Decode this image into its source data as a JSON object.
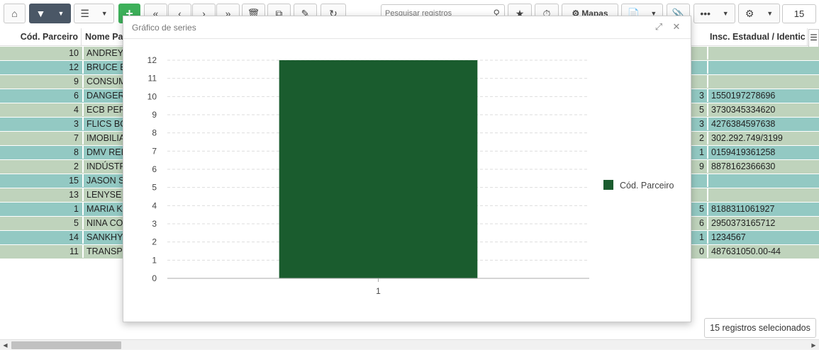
{
  "toolbar": {
    "search_placeholder": "Pesquisar registros",
    "mapas_label": "Mapas",
    "page_size": "15"
  },
  "grid": {
    "headers": {
      "cod": "Cód. Parceiro",
      "nome": "Nome Pa",
      "insc": "Insc. Estadual / Identic"
    },
    "rows": [
      {
        "cod": "10",
        "nome": "ANDREY",
        "mid": "",
        "insc": "",
        "color": "#bfd3bc"
      },
      {
        "cod": "12",
        "nome": "BRUCE E",
        "mid": "",
        "insc": "",
        "color": "#93c9c3"
      },
      {
        "cod": "9",
        "nome": "CONSUM",
        "mid": "",
        "insc": "",
        "color": "#bfd3bc"
      },
      {
        "cod": "6",
        "nome": "DANGER",
        "mid": "3",
        "insc": "1550197278696",
        "color": "#93c9c3"
      },
      {
        "cod": "4",
        "nome": "ECB PER",
        "mid": "5",
        "insc": "3730345334620",
        "color": "#bfd3bc"
      },
      {
        "cod": "3",
        "nome": "FLICS BO",
        "mid": "3",
        "insc": "4276384597638",
        "color": "#93c9c3"
      },
      {
        "cod": "7",
        "nome": "IMOBILIA",
        "mid": "2",
        "insc": "302.292.749/3199",
        "color": "#bfd3bc"
      },
      {
        "cod": "8",
        "nome": "DMV REI",
        "mid": "1",
        "insc": "0159419361258",
        "color": "#93c9c3"
      },
      {
        "cod": "2",
        "nome": "INDÚSTR",
        "mid": "9",
        "insc": "8878162366630",
        "color": "#bfd3bc"
      },
      {
        "cod": "15",
        "nome": "JASON S",
        "mid": "",
        "insc": "",
        "color": "#93c9c3"
      },
      {
        "cod": "13",
        "nome": "LENYSE",
        "mid": "",
        "insc": "",
        "color": "#bfd3bc"
      },
      {
        "cod": "1",
        "nome": "MARIA K",
        "mid": "5",
        "insc": "8188311061927",
        "color": "#93c9c3"
      },
      {
        "cod": "5",
        "nome": "NINA CO",
        "mid": "6",
        "insc": "2950373165712",
        "color": "#bfd3bc"
      },
      {
        "cod": "14",
        "nome": "SANKHY",
        "mid": "1",
        "insc": "1234567",
        "color": "#93c9c3"
      },
      {
        "cod": "11",
        "nome": "TRANSP",
        "mid": "0",
        "insc": "487631050.00-44",
        "color": "#bfd3bc"
      }
    ]
  },
  "selection_info": "15 registros selecionados",
  "modal": {
    "title": "Gráfico de series"
  },
  "chart_data": {
    "type": "bar",
    "categories": [
      "1"
    ],
    "series": [
      {
        "name": "Cód. Parceiro",
        "values": [
          12
        ],
        "color": "#1a5c2e"
      }
    ],
    "ylim": [
      0,
      12
    ],
    "yticks": [
      "0",
      "1",
      "2",
      "3",
      "4",
      "5",
      "6",
      "7",
      "8",
      "9",
      "10",
      "11",
      "12"
    ],
    "grid": true,
    "legend": "right"
  }
}
